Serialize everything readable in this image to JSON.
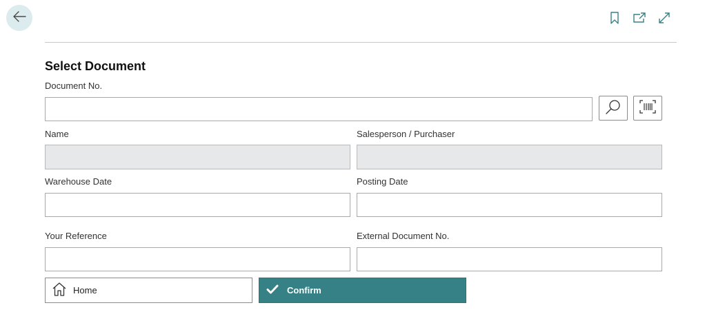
{
  "nav": {
    "back_icon": "arrow-left-icon",
    "actions": [
      "bookmark-icon",
      "open-in-new-window-icon",
      "expand-icon"
    ]
  },
  "form": {
    "title": "Select Document",
    "document_no": {
      "label": "Document No.",
      "value": ""
    },
    "name": {
      "label": "Name",
      "value": ""
    },
    "salesperson": {
      "label": "Salesperson / Purchaser",
      "value": ""
    },
    "warehouse_date": {
      "label": "Warehouse Date",
      "value": ""
    },
    "posting_date": {
      "label": "Posting Date",
      "value": ""
    },
    "your_reference": {
      "label": "Your Reference",
      "value": ""
    },
    "external_document_no": {
      "label": "External Document No.",
      "value": ""
    }
  },
  "buttons": {
    "home": "Home",
    "confirm": "Confirm"
  },
  "colors": {
    "accent": "#368185",
    "back_button_bg": "#dcebed",
    "readonly_field_bg": "#e7e8ea"
  }
}
